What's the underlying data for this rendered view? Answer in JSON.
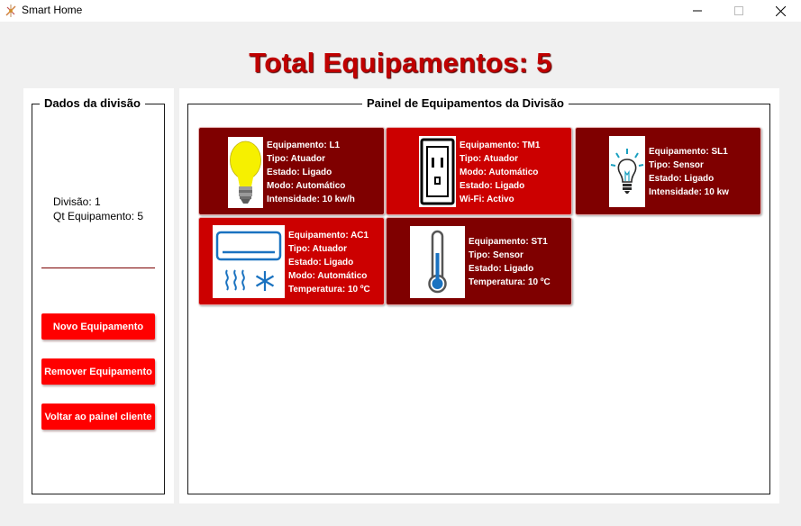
{
  "window": {
    "title": "Smart Home"
  },
  "header": {
    "title": "Total Equipamentos: 5"
  },
  "left_panel": {
    "legend": "Dados da divisão",
    "division_line": "Divisão: 1",
    "count_line": "Qt Equipamento: 5",
    "buttons": {
      "new": "Novo Equipamento",
      "remove": "Remover Equipamento",
      "back": "Voltar ao painel cliente"
    }
  },
  "right_panel": {
    "legend": "Painel de Equipamentos da Divisão",
    "devices": [
      {
        "icon": "light-bulb-icon",
        "lines": [
          "Equipamento: L1",
          "Tipo: Atuador",
          "Estado: Ligado",
          "Modo: Automático",
          "Intensidade: 10 kw/h"
        ]
      },
      {
        "icon": "power-outlet-icon",
        "lines": [
          "Equipamento: TM1",
          "Tipo: Atuador",
          "Modo: Automático",
          "Estado: Ligado",
          "Wi-Fi: Activo"
        ]
      },
      {
        "icon": "smart-light-sensor-icon",
        "lines": [
          "Equipamento: SL1",
          "Tipo: Sensor",
          "Estado: Ligado",
          "Intensidade: 10 kw"
        ]
      },
      {
        "icon": "air-conditioner-icon",
        "lines": [
          "Equipamento: AC1",
          "Tipo: Atuador",
          "Estado: Ligado",
          "Modo: Automático",
          "Temperatura: 10 ºC"
        ]
      },
      {
        "icon": "thermometer-icon",
        "lines": [
          "Equipamento: ST1",
          "Tipo: Sensor",
          "Estado: Ligado",
          "Temperatura: 10 ºC"
        ]
      }
    ]
  },
  "colors": {
    "title_red": "#c00000",
    "button_red": "#ff0000",
    "card_dark": "#7f0000",
    "card_bright": "#cc0000"
  }
}
